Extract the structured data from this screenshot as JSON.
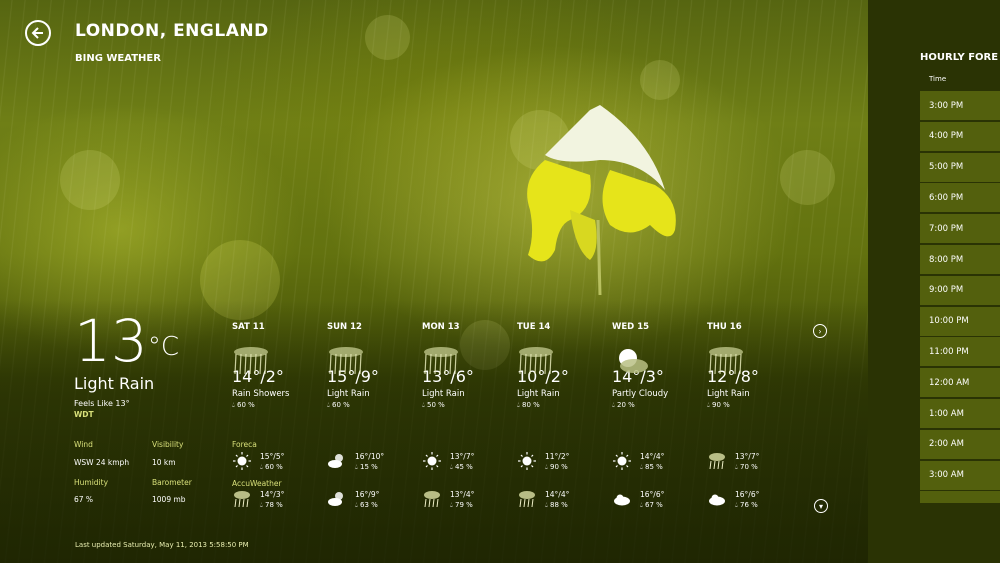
{
  "app": {
    "title": "LONDON, ENGLAND",
    "subtitle": "BING WEATHER"
  },
  "current": {
    "temp": "13",
    "unit": "°C",
    "condition": "Light Rain",
    "feels_like": "Feels Like 13°",
    "provider": "WDT",
    "wind_label": "Wind",
    "wind": "WSW 24 kmph",
    "visibility_label": "Visibility",
    "visibility": "10 km",
    "humidity_label": "Humidity",
    "humidity": "67 %",
    "barometer_label": "Barometer",
    "barometer": "1009 mb"
  },
  "providers": [
    "Foreca",
    "AccuWeather"
  ],
  "forecast": [
    {
      "day": "SAT 11",
      "hilo": "14°/2°",
      "cond": "Rain Showers",
      "precip": "60 %",
      "icon": "rain-icon",
      "foreca": {
        "hilo": "15°/5°",
        "precip": "60 %",
        "icon": "sun-icon"
      },
      "accu": {
        "hilo": "14°/3°",
        "precip": "78 %",
        "icon": "rain-icon"
      }
    },
    {
      "day": "SUN 12",
      "hilo": "15°/9°",
      "cond": "Light Rain",
      "precip": "60 %",
      "icon": "rain-icon",
      "foreca": {
        "hilo": "16°/10°",
        "precip": "15 %",
        "icon": "partly-cloudy-icon"
      },
      "accu": {
        "hilo": "16°/9°",
        "precip": "63 %",
        "icon": "partly-cloudy-icon"
      }
    },
    {
      "day": "MON 13",
      "hilo": "13°/6°",
      "cond": "Light Rain",
      "precip": "50 %",
      "icon": "rain-icon",
      "foreca": {
        "hilo": "13°/7°",
        "precip": "45 %",
        "icon": "sun-icon"
      },
      "accu": {
        "hilo": "13°/4°",
        "precip": "79 %",
        "icon": "rain-icon"
      }
    },
    {
      "day": "TUE 14",
      "hilo": "10°/2°",
      "cond": "Light Rain",
      "precip": "80 %",
      "icon": "rain-icon",
      "foreca": {
        "hilo": "11°/2°",
        "precip": "90 %",
        "icon": "sun-icon"
      },
      "accu": {
        "hilo": "14°/4°",
        "precip": "88 %",
        "icon": "rain-icon"
      }
    },
    {
      "day": "WED 15",
      "hilo": "14°/3°",
      "cond": "Partly Cloudy",
      "precip": "20 %",
      "icon": "partly-cloudy-icon",
      "foreca": {
        "hilo": "14°/4°",
        "precip": "85 %",
        "icon": "sun-icon"
      },
      "accu": {
        "hilo": "16°/6°",
        "precip": "67 %",
        "icon": "cloud-icon"
      }
    },
    {
      "day": "THU 16",
      "hilo": "12°/8°",
      "cond": "Light Rain",
      "precip": "90 %",
      "icon": "rain-icon",
      "foreca": {
        "hilo": "13°/7°",
        "precip": "70 %",
        "icon": "rain-icon"
      },
      "accu": {
        "hilo": "16°/6°",
        "precip": "76 %",
        "icon": "cloud-icon"
      }
    }
  ],
  "last_updated": "Last updated Saturday, May 11, 2013 5:58:50 PM",
  "hourly": {
    "title": "HOURLY FORE",
    "time_header": "Time",
    "times": [
      "3:00 PM",
      "4:00 PM",
      "5:00 PM",
      "6:00 PM",
      "7:00 PM",
      "8:00 PM",
      "9:00 PM",
      "10:00 PM",
      "11:00 PM",
      "12:00 AM",
      "1:00 AM",
      "2:00 AM",
      "3:00 AM",
      ""
    ]
  },
  "colors": {
    "accent": "#d8e07a",
    "panel": "#2a3304",
    "row": "#5a690f"
  }
}
